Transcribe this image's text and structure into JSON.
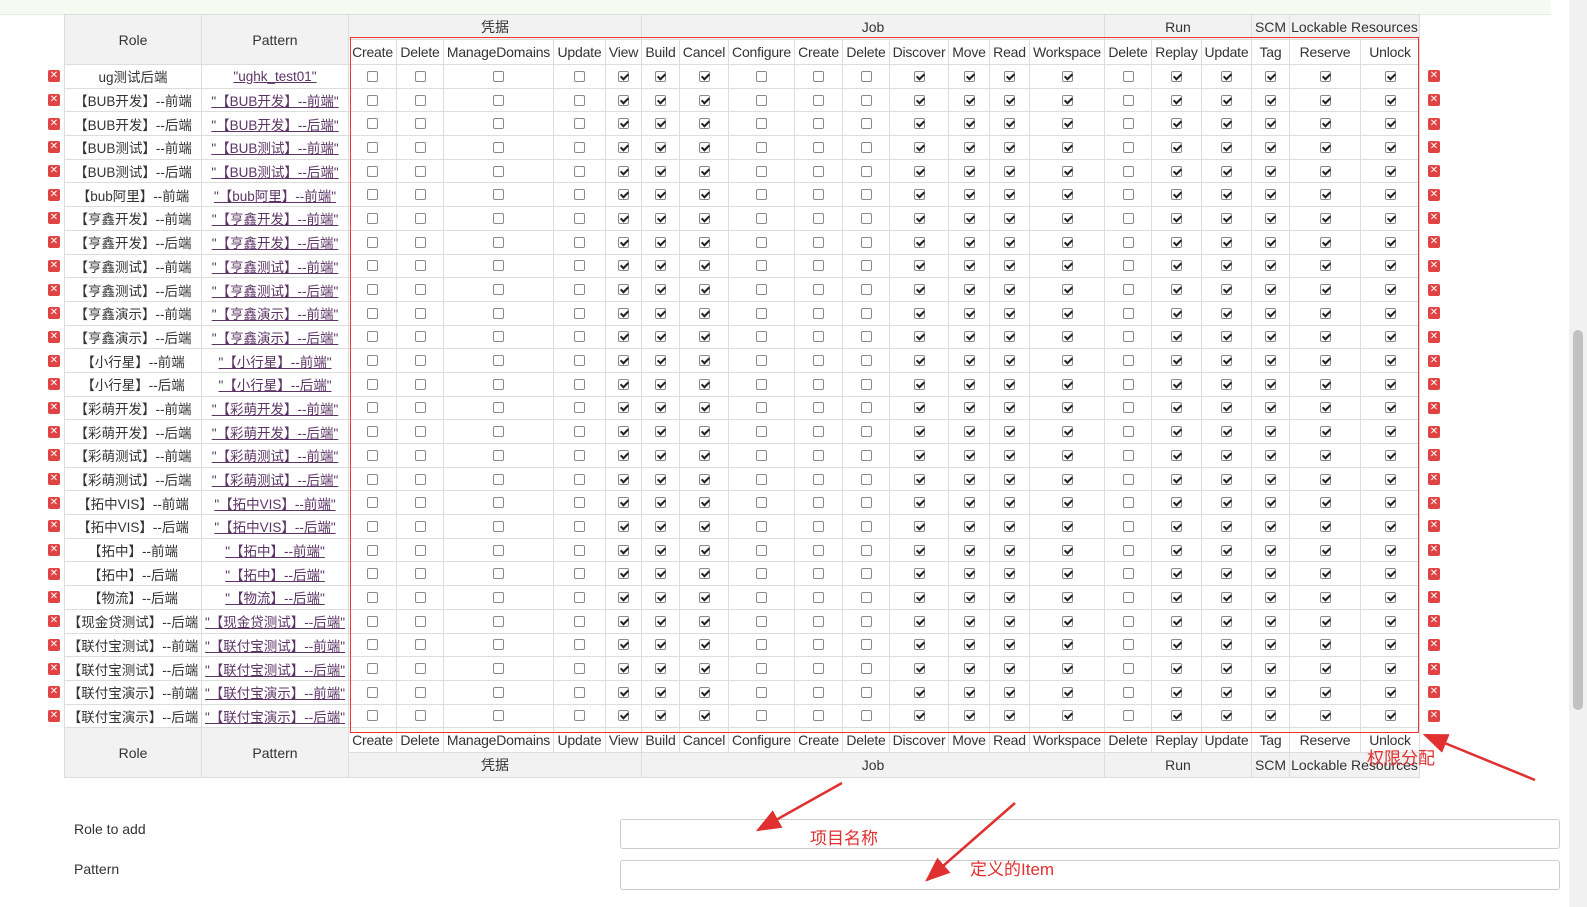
{
  "header": {
    "role": "Role",
    "pattern": "Pattern",
    "groups": [
      {
        "name": "凭据",
        "span": 5
      },
      {
        "name": "Job",
        "span": 9
      },
      {
        "name": "Run",
        "span": 3
      },
      {
        "name": "SCM",
        "span": 1
      },
      {
        "name": "Lockable Resources",
        "span": 2
      }
    ],
    "permissions": [
      "Create",
      "Delete",
      "ManageDomains",
      "Update",
      "View",
      "Build",
      "Cancel",
      "Configure",
      "Create",
      "Delete",
      "Discover",
      "Move",
      "Read",
      "Workspace",
      "Delete",
      "Replay",
      "Update",
      "Tag",
      "Reserve",
      "Unlock"
    ]
  },
  "default_checks": [
    false,
    false,
    false,
    false,
    true,
    true,
    true,
    false,
    false,
    false,
    true,
    true,
    true,
    true,
    false,
    true,
    true,
    true,
    true,
    true
  ],
  "rows": [
    {
      "role": "ug测试后端",
      "pattern": "\"ughk_test01\""
    },
    {
      "role": "【BUB开发】--前端",
      "pattern": "\"【BUB开发】--前端\""
    },
    {
      "role": "【BUB开发】--后端",
      "pattern": "\"【BUB开发】--后端\""
    },
    {
      "role": "【BUB测试】--前端",
      "pattern": "\"【BUB测试】--前端\""
    },
    {
      "role": "【BUB测试】--后端",
      "pattern": "\"【BUB测试】--后端\""
    },
    {
      "role": "【bub阿里】--前端",
      "pattern": "\"【bub阿里】--前端\""
    },
    {
      "role": "【亨鑫开发】--前端",
      "pattern": "\"【亨鑫开发】--前端\""
    },
    {
      "role": "【亨鑫开发】--后端",
      "pattern": "\"【亨鑫开发】--后端\""
    },
    {
      "role": "【亨鑫测试】--前端",
      "pattern": "\"【亨鑫测试】--前端\""
    },
    {
      "role": "【亨鑫测试】--后端",
      "pattern": "\"【亨鑫测试】--后端\""
    },
    {
      "role": "【亨鑫演示】--前端",
      "pattern": "\"【亨鑫演示】--前端\""
    },
    {
      "role": "【亨鑫演示】--后端",
      "pattern": "\"【亨鑫演示】--后端\""
    },
    {
      "role": "【小行星】--前端",
      "pattern": "\"【小行星】--前端\""
    },
    {
      "role": "【小行星】--后端",
      "pattern": "\"【小行星】--后端\""
    },
    {
      "role": "【彩萌开发】--前端",
      "pattern": "\"【彩萌开发】--前端\""
    },
    {
      "role": "【彩萌开发】--后端",
      "pattern": "\"【彩萌开发】--后端\""
    },
    {
      "role": "【彩萌测试】--前端",
      "pattern": "\"【彩萌测试】--前端\""
    },
    {
      "role": "【彩萌测试】--后端",
      "pattern": "\"【彩萌测试】--后端\""
    },
    {
      "role": "【拓中VIS】--前端",
      "pattern": "\"【拓中VIS】--前端\""
    },
    {
      "role": "【拓中VIS】--后端",
      "pattern": "\"【拓中VIS】--后端\""
    },
    {
      "role": "【拓中】--前端",
      "pattern": "\"【拓中】--前端\""
    },
    {
      "role": "【拓中】--后端",
      "pattern": "\"【拓中】--后端\""
    },
    {
      "role": "【物流】--后端",
      "pattern": "\"【物流】--后端\""
    },
    {
      "role": "【现金贷测试】--后端",
      "pattern": "\"【现金贷测试】--后端\""
    },
    {
      "role": "【联付宝测试】--前端",
      "pattern": "\"【联付宝测试】--前端\""
    },
    {
      "role": "【联付宝测试】--后端",
      "pattern": "\"【联付宝测试】--后端\""
    },
    {
      "role": "【联付宝演示】--前端",
      "pattern": "\"【联付宝演示】--前端\""
    },
    {
      "role": "【联付宝演示】--后端",
      "pattern": "\"【联付宝演示】--后端\""
    }
  ],
  "form": {
    "role_label": "Role to add",
    "role_value": "",
    "pattern_label": "Pattern",
    "pattern_value": ""
  },
  "annotations": {
    "permission": "权限分配",
    "project_name": "项目名称",
    "item": "定义的Item"
  },
  "colors": {
    "annotation": "#e03030",
    "delete_icon": "#e04343",
    "link": "#5c3566"
  }
}
